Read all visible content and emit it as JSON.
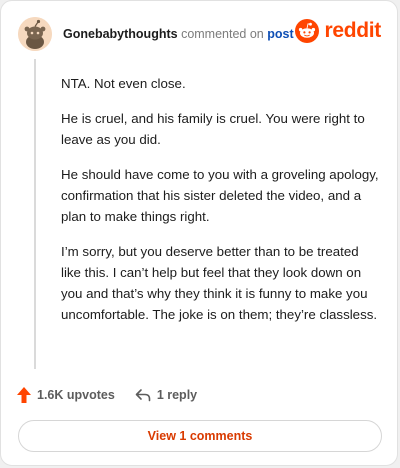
{
  "header": {
    "username": "Gonebabythoughts",
    "action_text": "commented on",
    "post_link": "post",
    "avatar_icon": "snoo-avatar-icon",
    "brand_icon": "reddit-alien-icon",
    "brand_word": "reddit"
  },
  "comment": {
    "paragraphs": [
      "NTA. Not even close.",
      "He is cruel, and his family is cruel. You were right to leave as you did.",
      "He should have come to you with a groveling apology, confirmation that his sister deleted the video, and a plan to make things right.",
      "I’m sorry, but you deserve better than to be treated like this. I can’t help but feel that they look down on you and that’s why they think it is funny to make you uncomfortable. The joke is on them; they’re classless."
    ]
  },
  "actions": {
    "upvotes": "1.6K upvotes",
    "upvote_icon": "upvote-arrow-icon",
    "reply": "1 reply",
    "reply_icon": "reply-arrow-icon"
  },
  "footer": {
    "view_button": "View 1 comments"
  },
  "colors": {
    "brand": "#ff4500",
    "link": "#0f4fb5",
    "button_text": "#d93a00"
  }
}
